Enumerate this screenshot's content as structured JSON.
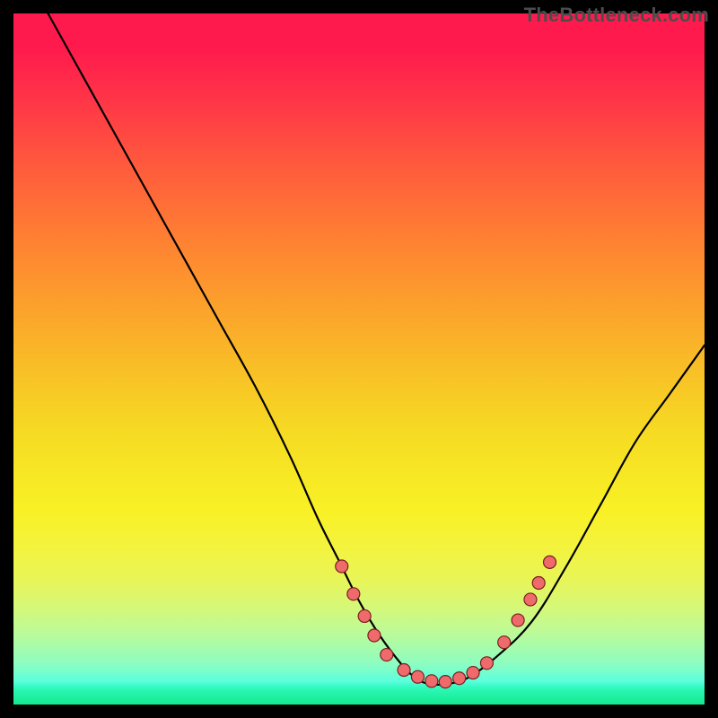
{
  "watermark": "TheBottleneck.com",
  "chart_data": {
    "type": "line",
    "title": "",
    "xlabel": "",
    "ylabel": "",
    "xlim": [
      0,
      100
    ],
    "ylim": [
      0,
      100
    ],
    "series": [
      {
        "name": "curve",
        "x": [
          5,
          10,
          15,
          20,
          25,
          30,
          35,
          40,
          44,
          47,
          50,
          53,
          56,
          58,
          60,
          63,
          66,
          70,
          75,
          80,
          85,
          90,
          95,
          100
        ],
        "y": [
          100,
          91,
          82,
          73,
          64,
          55,
          46,
          36,
          27,
          21,
          15,
          10,
          6,
          4,
          3,
          3,
          4,
          7,
          12,
          20,
          29,
          38,
          45,
          52
        ]
      }
    ],
    "markers": [
      {
        "x": 47.5,
        "y": 20.0
      },
      {
        "x": 49.2,
        "y": 16.0
      },
      {
        "x": 50.8,
        "y": 12.8
      },
      {
        "x": 52.2,
        "y": 10.0
      },
      {
        "x": 54.0,
        "y": 7.2
      },
      {
        "x": 56.5,
        "y": 5.0
      },
      {
        "x": 58.5,
        "y": 4.0
      },
      {
        "x": 60.5,
        "y": 3.4
      },
      {
        "x": 62.5,
        "y": 3.3
      },
      {
        "x": 64.5,
        "y": 3.8
      },
      {
        "x": 66.5,
        "y": 4.6
      },
      {
        "x": 68.5,
        "y": 6.0
      },
      {
        "x": 71.0,
        "y": 9.0
      },
      {
        "x": 73.0,
        "y": 12.2
      },
      {
        "x": 74.8,
        "y": 15.2
      },
      {
        "x": 76.0,
        "y": 17.6
      },
      {
        "x": 77.6,
        "y": 20.6
      }
    ]
  }
}
